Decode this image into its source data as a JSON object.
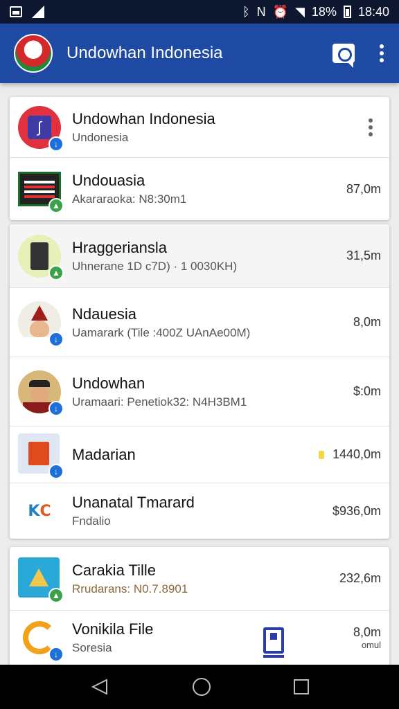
{
  "status_bar": {
    "battery": "18%",
    "time": "18:40"
  },
  "app_bar": {
    "title": "Undowhan Indonesia"
  },
  "card1": {
    "rows": [
      {
        "title": "Undowhan Indonesia",
        "subtitle": "Undonesia",
        "meta": ""
      },
      {
        "title": "Undouasia",
        "subtitle": "Akararaoka: N8:30m1",
        "meta": "87,0m"
      }
    ]
  },
  "card2": {
    "rows": [
      {
        "title": "Hraggeriansla",
        "subtitle": "Uhnerane 1D c7D) · 1 0030KH)",
        "meta": "31,5m"
      },
      {
        "title": "Ndauesia",
        "subtitle": "Uamarark (Tile :400Z UAnAe00M)",
        "meta": "8,0m"
      },
      {
        "title": "Undowhan",
        "subtitle": "Uramaari: Penetiok32: N4H3BM1",
        "meta": "$:0m"
      },
      {
        "title": "Madarian",
        "subtitle": "",
        "meta": "1440,0m"
      },
      {
        "title": "Unanatal Tmarard",
        "subtitle": "Fndalio",
        "meta": "$936,0m"
      }
    ]
  },
  "card3": {
    "rows": [
      {
        "title": "Carakia Tille",
        "subtitle": "Rrudarans: N0.7.8901",
        "meta": "232,6m"
      },
      {
        "title": "Vonikila File",
        "subtitle": "Soresia",
        "meta": "8,0m",
        "meta2": "omul"
      }
    ]
  }
}
